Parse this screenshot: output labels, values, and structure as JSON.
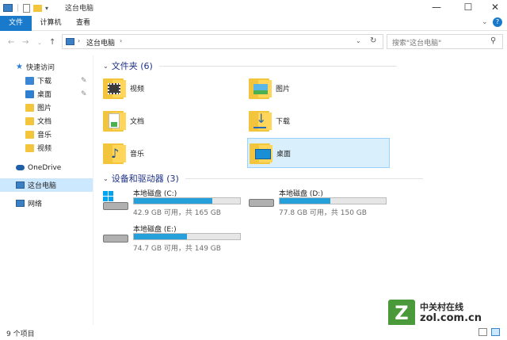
{
  "window": {
    "title": "这台电脑"
  },
  "ribbon": {
    "tabs": [
      "文件",
      "计算机",
      "查看"
    ]
  },
  "address": {
    "path": "这台电脑"
  },
  "search": {
    "placeholder": "搜索\"这台电脑\""
  },
  "sidebar": {
    "quick_access": "快速访问",
    "items": [
      {
        "label": "下载",
        "icon": "download-icon",
        "pinned": true
      },
      {
        "label": "桌面",
        "icon": "desktop-icon",
        "pinned": true
      },
      {
        "label": "图片",
        "icon": "pictures-icon",
        "pinned": false
      },
      {
        "label": "文档",
        "icon": "documents-icon",
        "pinned": false
      },
      {
        "label": "音乐",
        "icon": "music-icon",
        "pinned": false
      },
      {
        "label": "视频",
        "icon": "videos-icon",
        "pinned": false
      }
    ],
    "onedrive": "OneDrive",
    "this_pc": "这台电脑",
    "network": "网络"
  },
  "folders_group": {
    "title": "文件夹 (6)",
    "folders": [
      "视频",
      "图片",
      "文档",
      "下载",
      "音乐",
      "桌面"
    ],
    "selected": "桌面"
  },
  "drives_group": {
    "title": "设备和驱动器 (3)",
    "drives": [
      {
        "name": "本地磁盘 (C:)",
        "info": "42.9 GB 可用，共 165 GB",
        "used_fraction": 0.74
      },
      {
        "name": "本地磁盘 (D:)",
        "info": "77.8 GB 可用，共 150 GB",
        "used_fraction": 0.48
      },
      {
        "name": "本地磁盘 (E:)",
        "info": "74.7 GB 可用，共 149 GB",
        "used_fraction": 0.5
      }
    ]
  },
  "status": {
    "count": "9 个项目"
  },
  "watermark": {
    "brand": "中关村在线",
    "site": "zol.com.cn"
  },
  "colors": {
    "accent": "#1979ca",
    "folder": "#ffd65a",
    "drive_bar": "#26a0da",
    "selection": "#cce8ff",
    "group_title": "#1e3287"
  }
}
